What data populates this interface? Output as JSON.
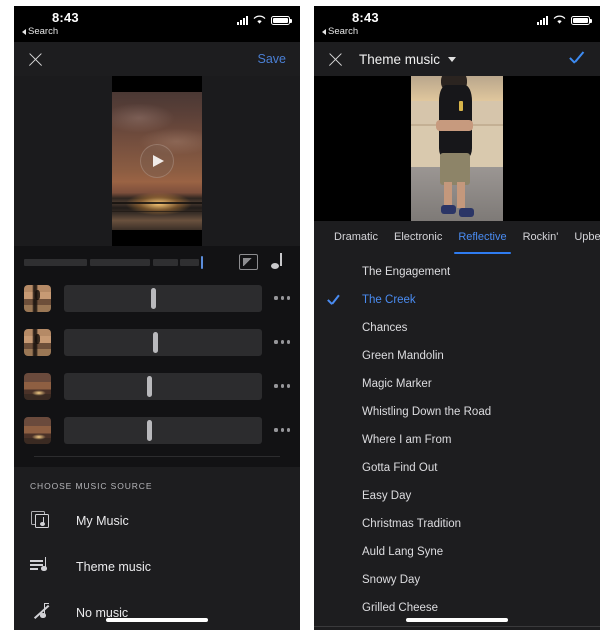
{
  "status_bar": {
    "time": "8:43",
    "back_label": "Search",
    "icons": [
      "cellular-icon",
      "wifi-icon",
      "battery-icon"
    ]
  },
  "left_panel": {
    "nav": {
      "close_label": "✕",
      "close_icon": "close-icon",
      "save_label": "Save",
      "save_color": "#4a7fd4"
    },
    "preview": {
      "play_icon": "play-icon"
    },
    "scrubber": {
      "crop_icon": "crop-icon",
      "music_note_icon": "music-note-icon",
      "playhead_position_pct": 83,
      "segments_pct": [
        [
          0,
          31
        ],
        [
          32,
          30
        ],
        [
          63,
          37
        ]
      ]
    },
    "clips": [
      {
        "thumbnail": "kid-thumbnail",
        "knob_position_pct": 44,
        "menu_icon": "more-options-icon"
      },
      {
        "thumbnail": "kid-thumbnail",
        "knob_position_pct": 45,
        "menu_icon": "more-options-icon"
      },
      {
        "thumbnail": "sunset-thumbnail",
        "knob_position_pct": 42,
        "menu_icon": "more-options-icon"
      },
      {
        "thumbnail": "sunset-thumbnail",
        "knob_position_pct": 42,
        "menu_icon": "more-options-icon"
      }
    ],
    "music_source": {
      "section_label": "CHOOSE MUSIC SOURCE",
      "items": [
        {
          "label": "My Music",
          "icon": "library-music-icon"
        },
        {
          "label": "Theme music",
          "icon": "playlist-music-icon"
        },
        {
          "label": "No music",
          "icon": "music-off-icon"
        }
      ]
    }
  },
  "right_panel": {
    "nav": {
      "close_icon": "close-icon",
      "title": "Theme music",
      "caret_icon": "chevron-down-icon",
      "confirm_icon": "check-icon",
      "confirm_color": "#3d8bf2"
    },
    "tabs": [
      {
        "label": "Dramatic",
        "active": false
      },
      {
        "label": "Electronic",
        "active": false
      },
      {
        "label": "Reflective",
        "active": true
      },
      {
        "label": "Rockin'",
        "active": false
      },
      {
        "label": "Upbeat",
        "active": false
      }
    ],
    "tab_accent_color": "#2f7cf0",
    "tracks": [
      {
        "name": "The Engagement",
        "selected": false
      },
      {
        "name": "The Creek",
        "selected": true
      },
      {
        "name": "Chances",
        "selected": false
      },
      {
        "name": "Green Mandolin",
        "selected": false
      },
      {
        "name": "Magic Marker",
        "selected": false
      },
      {
        "name": "Whistling Down the Road",
        "selected": false
      },
      {
        "name": "Where I am From",
        "selected": false
      },
      {
        "name": "Gotta Find Out",
        "selected": false
      },
      {
        "name": "Easy Day",
        "selected": false
      },
      {
        "name": "Christmas Tradition",
        "selected": false
      },
      {
        "name": "Auld Lang Syne",
        "selected": false
      },
      {
        "name": "Snowy Day",
        "selected": false
      },
      {
        "name": "Grilled Cheese",
        "selected": false
      }
    ]
  }
}
